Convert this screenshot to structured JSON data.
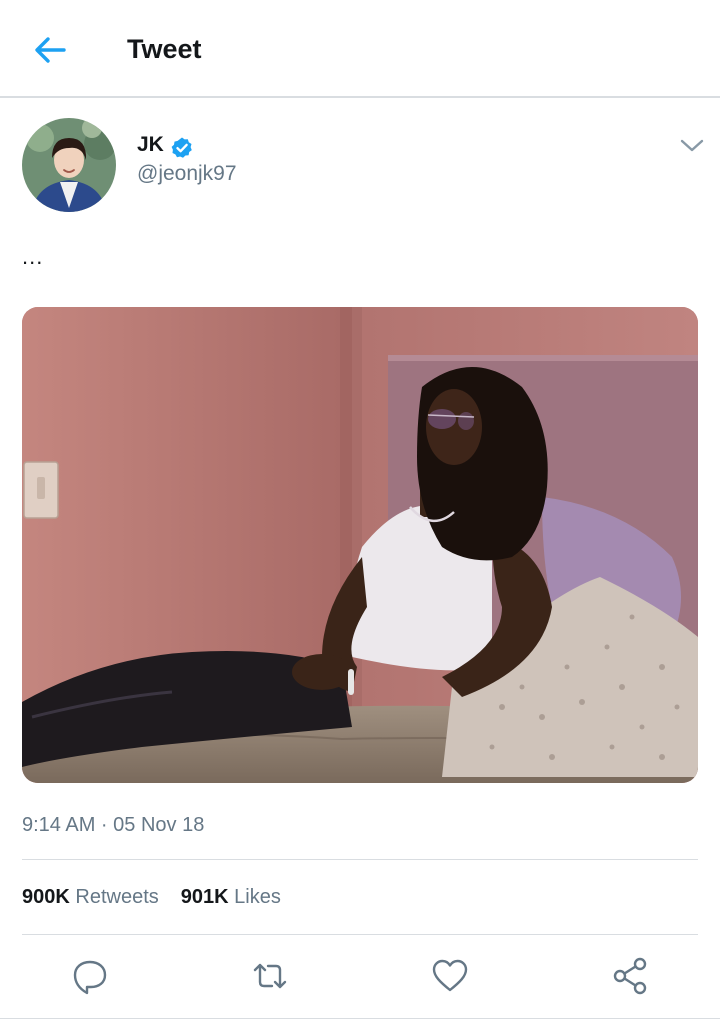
{
  "header": {
    "title": "Tweet",
    "back_icon": "arrow-left-icon",
    "accent_color": "#1da1f2"
  },
  "tweet": {
    "author_name": "JK",
    "author_handle": "@jeonjk97",
    "verified": true,
    "text": "...",
    "timestamp": "9:14 AM · 05 Nov 18",
    "retweets_count": "900K",
    "retweets_label": "Retweets",
    "likes_count": "901K",
    "likes_label": "Likes"
  },
  "actions": [
    {
      "icon": "reply-icon"
    },
    {
      "icon": "retweet-icon"
    },
    {
      "icon": "like-icon"
    },
    {
      "icon": "share-icon"
    }
  ],
  "colors": {
    "text": "#14171a",
    "secondary_text": "#657786",
    "divider": "#d9dde1",
    "icon": "#657786"
  }
}
